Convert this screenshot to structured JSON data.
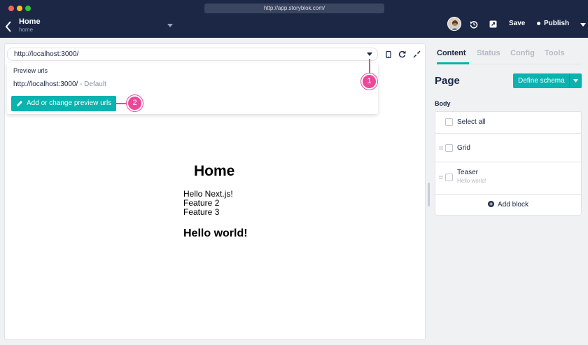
{
  "browser": {
    "url": "http://app.storyblok.com/"
  },
  "header": {
    "story_title": "Home",
    "story_slug": "home",
    "save_label": "Save",
    "publish_label": "Publish"
  },
  "preview": {
    "url_value": "http://localhost:3000/",
    "dropdown": {
      "heading": "Preview urls",
      "default_url": "http://localhost:3000/",
      "default_suffix": " - Default",
      "change_button": "Add or change preview urls"
    },
    "callouts": [
      "1",
      "2"
    ],
    "page": {
      "heading": "Home",
      "lines": [
        "Hello Next.js!",
        "Feature 2",
        "Feature 3"
      ],
      "subheading": "Hello world!"
    }
  },
  "panel": {
    "tabs": [
      "Content",
      "Status",
      "Config",
      "Tools"
    ],
    "active_tab": "Content",
    "page_title": "Page",
    "define_schema": "Define schema",
    "body_label": "Body",
    "select_all": "Select all",
    "blocks": [
      {
        "name": "Grid",
        "subtitle": ""
      },
      {
        "name": "Teaser",
        "subtitle": "Hello world!"
      }
    ],
    "add_block": "Add block"
  },
  "colors": {
    "brand": "#09b3af",
    "header_bg": "#1b2744",
    "callout": "#ec4899"
  }
}
